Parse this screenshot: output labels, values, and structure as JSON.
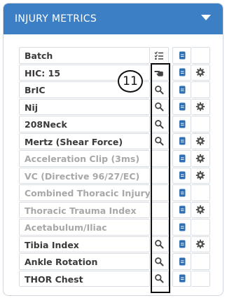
{
  "panel": {
    "title": "INJURY METRICS",
    "collapse_icon": "caret-down-icon",
    "header_color": "#3c7fc5"
  },
  "callout": {
    "number": "11"
  },
  "colors": {
    "text_enabled": "#3a3a3a",
    "text_disabled": "#a8a8a8",
    "doc_icon": "#2f6fb4",
    "gear_icon": "#555555",
    "search_icon": "#444444"
  },
  "rows": [
    {
      "label": "Batch",
      "enabled": true,
      "action_icon": "checklist-icon",
      "doc": true,
      "gear": false
    },
    {
      "label": "HIC: 15",
      "enabled": true,
      "action_icon": "pointing-hand-icon",
      "doc": true,
      "gear": true
    },
    {
      "label": "BrIC",
      "enabled": true,
      "action_icon": "search-icon",
      "doc": true,
      "gear": false
    },
    {
      "label": "Nij",
      "enabled": true,
      "action_icon": "search-icon",
      "doc": true,
      "gear": true
    },
    {
      "label": "208Neck",
      "enabled": true,
      "action_icon": "search-icon",
      "doc": true,
      "gear": false
    },
    {
      "label": "Mertz (Shear Force)",
      "enabled": true,
      "action_icon": "search-icon",
      "doc": true,
      "gear": true
    },
    {
      "label": "Acceleration Clip (3ms)",
      "enabled": false,
      "action_icon": "",
      "doc": true,
      "gear": true
    },
    {
      "label": "VC (Directive 96/27/EC)",
      "enabled": false,
      "action_icon": "",
      "doc": true,
      "gear": true
    },
    {
      "label": "Combined Thoracic Injury",
      "enabled": false,
      "action_icon": "",
      "doc": true,
      "gear": false
    },
    {
      "label": "Thoracic Trauma Index",
      "enabled": false,
      "action_icon": "",
      "doc": true,
      "gear": true
    },
    {
      "label": "Acetabulum/Iliac",
      "enabled": false,
      "action_icon": "",
      "doc": true,
      "gear": false
    },
    {
      "label": "Tibia Index",
      "enabled": true,
      "action_icon": "search-icon",
      "doc": true,
      "gear": true
    },
    {
      "label": "Ankle Rotation",
      "enabled": true,
      "action_icon": "search-icon",
      "doc": true,
      "gear": false
    },
    {
      "label": "THOR Chest",
      "enabled": true,
      "action_icon": "search-icon",
      "doc": true,
      "gear": false
    }
  ]
}
